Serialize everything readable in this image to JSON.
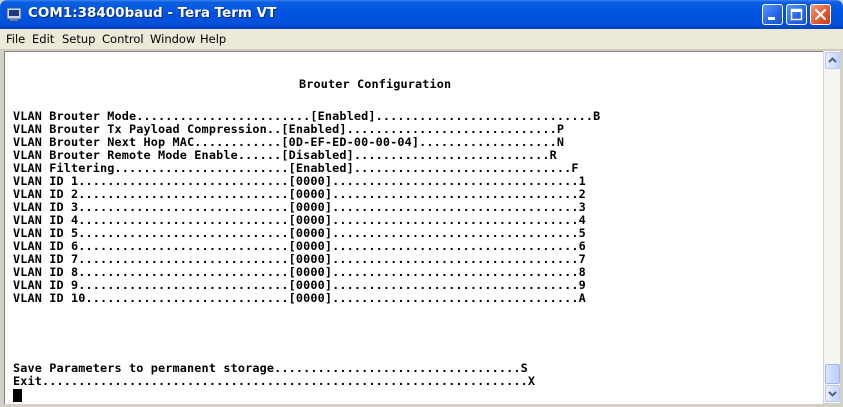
{
  "window": {
    "title": "COM1:38400baud - Tera Term VT",
    "icon": "teraterm-app-icon"
  },
  "menu": [
    "File",
    "Edit",
    "Setup",
    "Control",
    "Window",
    "Help"
  ],
  "terminal": {
    "heading": "Brouter Configuration",
    "lines": [
      "VLAN Brouter Mode........................[Enabled]..............................B",
      "VLAN Brouter Tx Payload Compression..[Enabled].............................P",
      "VLAN Brouter Next Hop MAC............[0D-EF-ED-00-00-04]...................N",
      "VLAN Brouter Remote Mode Enable......[Disabled]...........................R",
      "VLAN Filtering........................[Enabled]..............................F",
      "VLAN ID 1.............................[0000]..................................1",
      "VLAN ID 2.............................[0000]..................................2",
      "VLAN ID 3.............................[0000]..................................3",
      "VLAN ID 4.............................[0000]..................................4",
      "VLAN ID 5.............................[0000]..................................5",
      "VLAN ID 6.............................[0000]..................................6",
      "VLAN ID 7.............................[0000]..................................7",
      "VLAN ID 8.............................[0000]..................................8",
      "VLAN ID 9.............................[0000]..................................9",
      "VLAN ID 10............................[0000]..................................A"
    ],
    "save_line": "Save Parameters to permanent storage..................................S",
    "exit_line": "Exit...................................................................X"
  }
}
